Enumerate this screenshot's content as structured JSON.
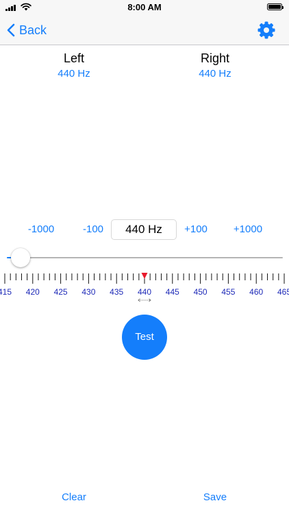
{
  "status_bar": {
    "time": "8:00 AM"
  },
  "nav": {
    "back_label": "Back",
    "settings_icon": "gear-icon",
    "accent_color": "#147efb"
  },
  "channels": {
    "left": {
      "title": "Left",
      "frequency": "440 Hz"
    },
    "right": {
      "title": "Right",
      "frequency": "440 Hz"
    }
  },
  "stepper": {
    "minus_1000": "-1000",
    "minus_100": "-100",
    "current_value": "440 Hz",
    "plus_100": "+100",
    "plus_1000": "+1000"
  },
  "slider": {
    "level": 0.0
  },
  "ruler": {
    "labels": [
      "415",
      "420",
      "425",
      "430",
      "435",
      "440",
      "445",
      "450",
      "455",
      "460",
      "465"
    ],
    "marker_value": 440,
    "label_color": "#1f2bb8",
    "marker_color": "#e8192c"
  },
  "actions": {
    "test_label": "Test",
    "clear_label": "Clear",
    "save_label": "Save"
  }
}
